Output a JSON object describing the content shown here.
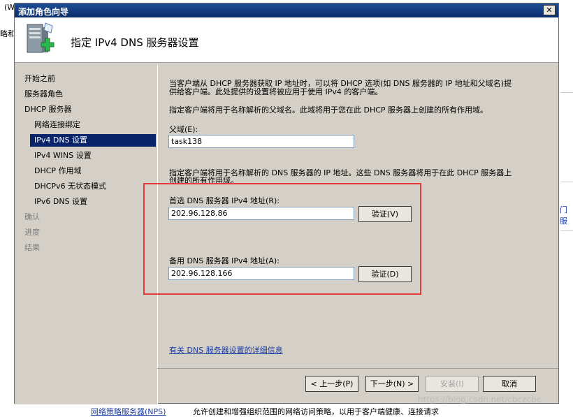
{
  "background": {
    "top_left_frag": "(W",
    "left_frag": "略和",
    "right_frag": "门服",
    "footer_link": "网络策略服务器(NPS)",
    "footer_text": "允许创建和增强组织范围的网络访问策略，以用于客户端健康、连接请求",
    "watermark": "https://blog.csdn.net/cbczcbc"
  },
  "window": {
    "title": "添加角色向导",
    "close_glyph": "✕"
  },
  "header": {
    "title": "指定 IPv4 DNS 服务器设置"
  },
  "nav": {
    "items": [
      {
        "label": "开始之前"
      },
      {
        "label": "服务器角色"
      },
      {
        "label": "DHCP 服务器"
      },
      {
        "label": "网络连接绑定"
      },
      {
        "label": "IPv4 DNS 设置"
      },
      {
        "label": "IPv4 WINS 设置"
      },
      {
        "label": "DHCP 作用域"
      },
      {
        "label": "DHCPv6 无状态模式"
      },
      {
        "label": "IPv6 DNS 设置"
      },
      {
        "label": "确认"
      },
      {
        "label": "进度"
      },
      {
        "label": "结果"
      }
    ]
  },
  "content": {
    "intro_line1": "当客户端从 DHCP 服务器获取 IP 地址时，可以将 DHCP 选项(如 DNS 服务器的 IP 地址和父域名)提",
    "intro_line2": "供给客户端。此处提供的设置将被应用于使用 IPv4 的客户端。",
    "parent_desc": "指定客户端将用于名称解析的父域名。此域将用于您在此 DHCP 服务器上创建的所有作用域。",
    "parent_label": "父域(E):",
    "parent_value": "task138",
    "dns_desc_line1": "指定客户端将用于名称解析的 DNS 服务器的 IP 地址。这些 DNS 服务器将用于在此 DHCP 服务器上",
    "dns_desc_line2": "创建的所有作用域。",
    "preferred_label": "首选 DNS 服务器 IPv4 地址(R):",
    "preferred_value": "202.96.128.86",
    "validate1": "验证(V)",
    "alternate_label": "备用 DNS 服务器 IPv4 地址(A):",
    "alternate_value": "202.96.128.166",
    "validate2": "验证(D)",
    "more_info_link": "有关 DNS 服务器设置的详细信息"
  },
  "buttons": {
    "back": "< 上一步(P)",
    "next": "下一步(N) >",
    "install": "安装(I)",
    "cancel": "取消"
  },
  "colors": {
    "title_bar": "#0a2d6e",
    "selection": "#0a246a",
    "highlight_box": "#e53c3c",
    "link": "#1a3da0"
  }
}
